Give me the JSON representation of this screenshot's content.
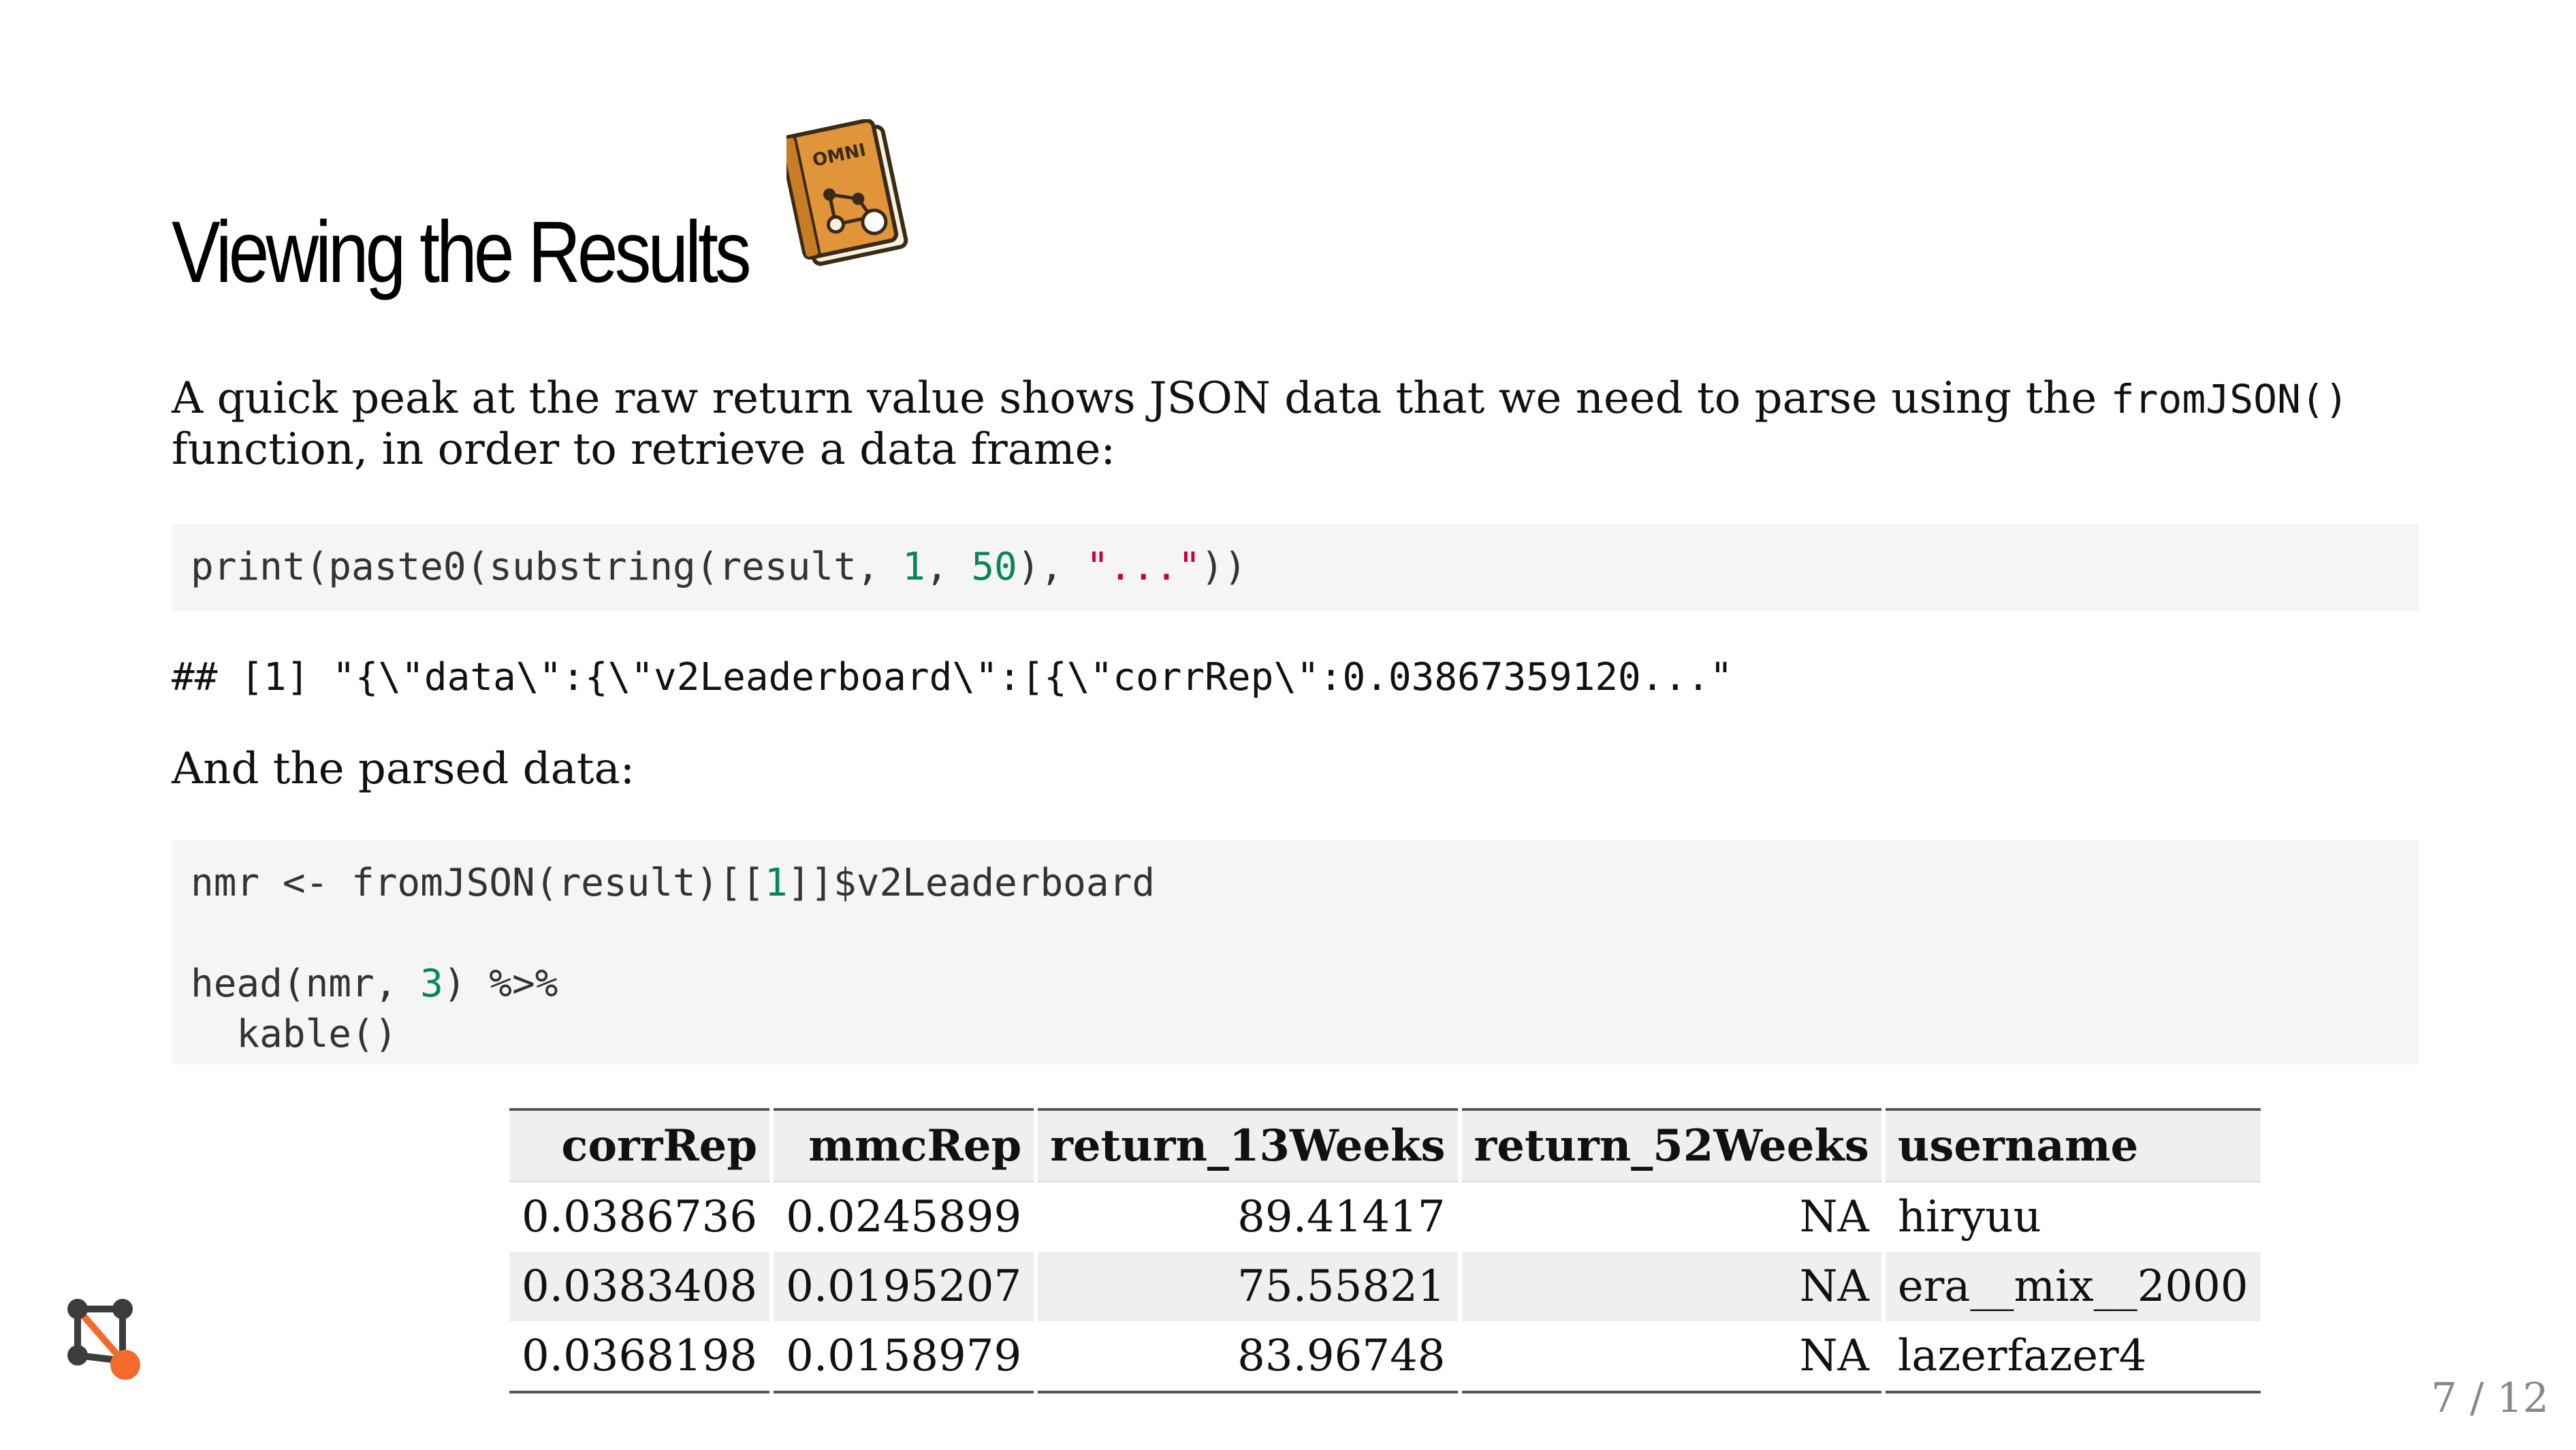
{
  "slide": {
    "title": "Viewing the Results",
    "title_icon": "omni-book-icon",
    "omni_label": "OMNI",
    "intro_before": "A quick peak at the raw return value shows JSON data that we need to parse using the ",
    "intro_code": "fromJSON()",
    "intro_after": " function, in order to retrieve a data frame:",
    "code1": {
      "a": "print(paste0(substring(result, ",
      "n1": "1",
      "b": ", ",
      "n2": "50",
      "c": "), ",
      "s1": "\"...\"",
      "d": "))"
    },
    "output1": "## [1] \"{\\\"data\\\":{\\\"v2Leaderboard\\\":[{\\\"corrRep\\\":0.03867359120...\"",
    "parsed_label": "And the parsed data:",
    "code2": {
      "l1a": "nmr <- fromJSON(result)[[",
      "l1n": "1",
      "l1b": "]]$v2Leaderboard",
      "l3a": "head(nmr, ",
      "l3n": "3",
      "l3b": ") %>%",
      "l4": "  kable()"
    },
    "table": {
      "headers": [
        "corrRep",
        "mmcRep",
        "return_13Weeks",
        "return_52Weeks",
        "username"
      ],
      "rows": [
        [
          "0.0386736",
          "0.0245899",
          "89.41417",
          "NA",
          "hiryuu"
        ],
        [
          "0.0383408",
          "0.0195207",
          "75.55821",
          "NA",
          "era__mix__2000"
        ],
        [
          "0.0368198",
          "0.0158979",
          "83.96748",
          "NA",
          "lazerfazer4"
        ]
      ]
    },
    "logo_icon": "graph-logo-icon",
    "page_number": "7 / 12"
  }
}
